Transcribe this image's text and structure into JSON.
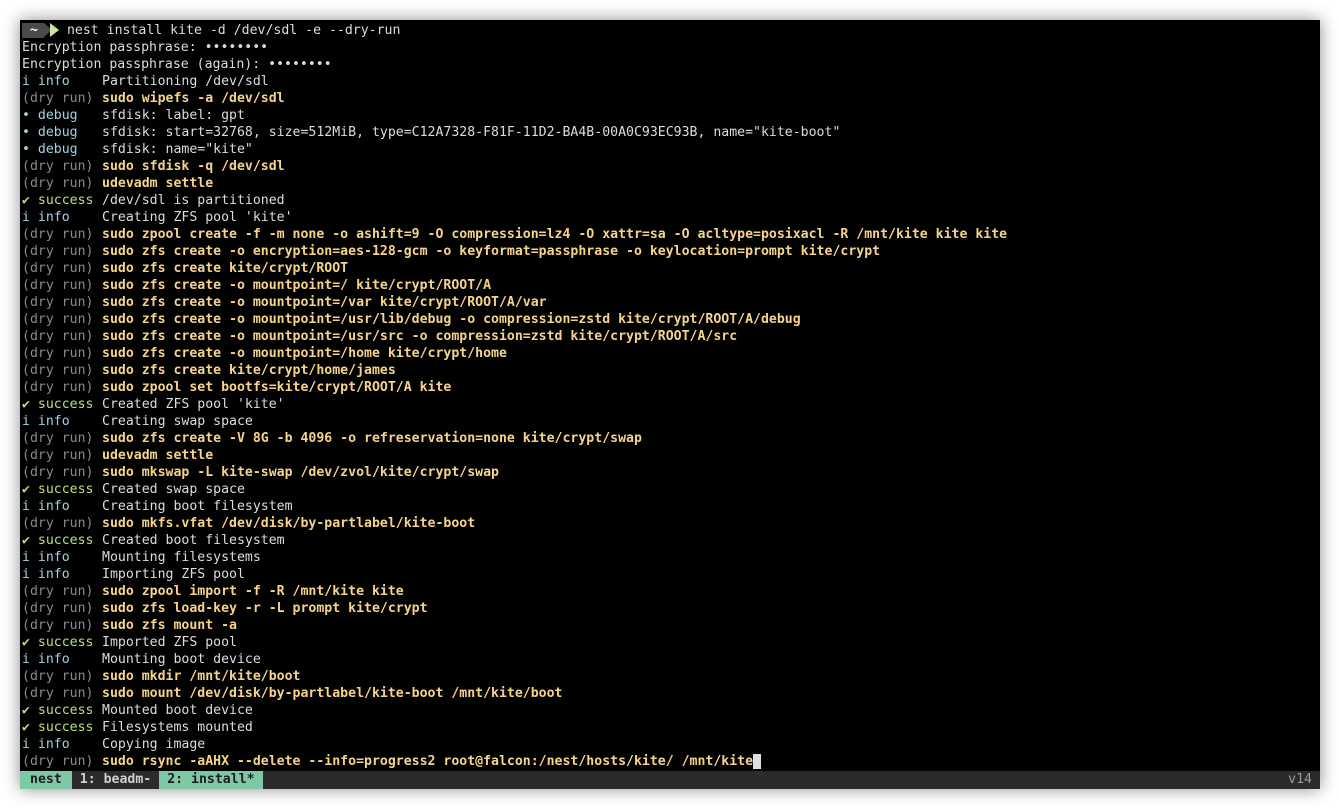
{
  "prompt": {
    "cwd": "~",
    "command": "nest install kite -d /dev/sdl -e --dry-run"
  },
  "lines": [
    {
      "type": "plain",
      "text": "Encryption passphrase: ••••••••"
    },
    {
      "type": "plain",
      "text": "Encryption passphrase (again): ••••••••"
    },
    {
      "type": "info",
      "tag": "i info",
      "text": "Partitioning /dev/sdl"
    },
    {
      "type": "dry",
      "tag": "(dry run)",
      "text": "sudo wipefs -a /dev/sdl"
    },
    {
      "type": "debug",
      "tag": "• debug",
      "text": "sfdisk: label: gpt"
    },
    {
      "type": "debug",
      "tag": "• debug",
      "text": "sfdisk: start=32768, size=512MiB, type=C12A7328-F81F-11D2-BA4B-00A0C93EC93B, name=\"kite-boot\""
    },
    {
      "type": "debug",
      "tag": "• debug",
      "text": "sfdisk: name=\"kite\""
    },
    {
      "type": "dry",
      "tag": "(dry run)",
      "text": "sudo sfdisk -q /dev/sdl"
    },
    {
      "type": "dry",
      "tag": "(dry run)",
      "text": "udevadm settle"
    },
    {
      "type": "success",
      "tag": "✔ success",
      "text": "/dev/sdl is partitioned"
    },
    {
      "type": "info",
      "tag": "i info",
      "text": "Creating ZFS pool 'kite'"
    },
    {
      "type": "dry",
      "tag": "(dry run)",
      "text": "sudo zpool create -f -m none -o ashift=9 -O compression=lz4 -O xattr=sa -O acltype=posixacl -R /mnt/kite kite kite"
    },
    {
      "type": "dry",
      "tag": "(dry run)",
      "text": "sudo zfs create -o encryption=aes-128-gcm -o keyformat=passphrase -o keylocation=prompt kite/crypt"
    },
    {
      "type": "dry",
      "tag": "(dry run)",
      "text": "sudo zfs create kite/crypt/ROOT"
    },
    {
      "type": "dry",
      "tag": "(dry run)",
      "text": "sudo zfs create -o mountpoint=/ kite/crypt/ROOT/A"
    },
    {
      "type": "dry",
      "tag": "(dry run)",
      "text": "sudo zfs create -o mountpoint=/var kite/crypt/ROOT/A/var"
    },
    {
      "type": "dry",
      "tag": "(dry run)",
      "text": "sudo zfs create -o mountpoint=/usr/lib/debug -o compression=zstd kite/crypt/ROOT/A/debug"
    },
    {
      "type": "dry",
      "tag": "(dry run)",
      "text": "sudo zfs create -o mountpoint=/usr/src -o compression=zstd kite/crypt/ROOT/A/src"
    },
    {
      "type": "dry",
      "tag": "(dry run)",
      "text": "sudo zfs create -o mountpoint=/home kite/crypt/home"
    },
    {
      "type": "dry",
      "tag": "(dry run)",
      "text": "sudo zfs create kite/crypt/home/james"
    },
    {
      "type": "dry",
      "tag": "(dry run)",
      "text": "sudo zpool set bootfs=kite/crypt/ROOT/A kite"
    },
    {
      "type": "success",
      "tag": "✔ success",
      "text": "Created ZFS pool 'kite'"
    },
    {
      "type": "info",
      "tag": "i info",
      "text": "Creating swap space"
    },
    {
      "type": "dry",
      "tag": "(dry run)",
      "text": "sudo zfs create -V 8G -b 4096 -o refreservation=none kite/crypt/swap"
    },
    {
      "type": "dry",
      "tag": "(dry run)",
      "text": "udevadm settle"
    },
    {
      "type": "dry",
      "tag": "(dry run)",
      "text": "sudo mkswap -L kite-swap /dev/zvol/kite/crypt/swap"
    },
    {
      "type": "success",
      "tag": "✔ success",
      "text": "Created swap space"
    },
    {
      "type": "info",
      "tag": "i info",
      "text": "Creating boot filesystem"
    },
    {
      "type": "dry",
      "tag": "(dry run)",
      "text": "sudo mkfs.vfat /dev/disk/by-partlabel/kite-boot"
    },
    {
      "type": "success",
      "tag": "✔ success",
      "text": "Created boot filesystem"
    },
    {
      "type": "info",
      "tag": "i info",
      "text": "Mounting filesystems"
    },
    {
      "type": "info",
      "tag": "i info",
      "text": "Importing ZFS pool"
    },
    {
      "type": "dry",
      "tag": "(dry run)",
      "text": "sudo zpool import -f -R /mnt/kite kite"
    },
    {
      "type": "dry",
      "tag": "(dry run)",
      "text": "sudo zfs load-key -r -L prompt kite/crypt"
    },
    {
      "type": "dry",
      "tag": "(dry run)",
      "text": "sudo zfs mount -a"
    },
    {
      "type": "success",
      "tag": "✔ success",
      "text": "Imported ZFS pool"
    },
    {
      "type": "info",
      "tag": "i info",
      "text": "Mounting boot device"
    },
    {
      "type": "dry",
      "tag": "(dry run)",
      "text": "sudo mkdir /mnt/kite/boot"
    },
    {
      "type": "dry",
      "tag": "(dry run)",
      "text": "sudo mount /dev/disk/by-partlabel/kite-boot /mnt/kite/boot"
    },
    {
      "type": "success",
      "tag": "✔ success",
      "text": "Mounted boot device"
    },
    {
      "type": "success",
      "tag": "✔ success",
      "text": "Filesystems mounted"
    },
    {
      "type": "info",
      "tag": "i info",
      "text": "Copying image"
    },
    {
      "type": "dry",
      "tag": "(dry run)",
      "text": "sudo rsync -aAHX --delete --info=progress2 root@falcon:/nest/hosts/kite/ /mnt/kite",
      "cursor": true
    }
  ],
  "statusbar": {
    "session": "nest",
    "windows": [
      {
        "label": "1: beadm-",
        "active": false
      },
      {
        "label": "2: install*",
        "active": true
      }
    ],
    "version": "v14"
  }
}
